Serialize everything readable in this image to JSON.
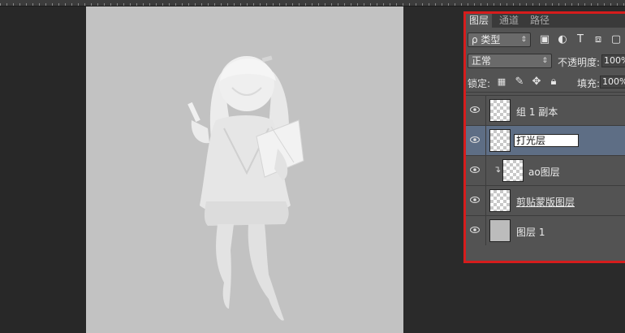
{
  "panel": {
    "tabs": [
      "图层",
      "通道",
      "路径"
    ],
    "filter": {
      "label": "ρ 类型",
      "icons": [
        "image-filter-icon",
        "adjustment-filter-icon",
        "type-filter-icon",
        "shape-filter-icon",
        "smart-object-filter-icon"
      ]
    },
    "blend_mode": "正常",
    "opacity_label": "不透明度:",
    "opacity_value": "100%",
    "lock_label": "锁定:",
    "fill_label": "填充:",
    "fill_value": "100%",
    "layers": [
      {
        "name": "组 1 副本",
        "visible": true,
        "selected": false
      },
      {
        "name": "打光层",
        "visible": true,
        "selected": true,
        "editing": true
      },
      {
        "name": "ao图层",
        "visible": true,
        "selected": false,
        "clipped": true
      },
      {
        "name": "剪贴蒙版图层",
        "visible": true,
        "selected": false
      },
      {
        "name": "图层 1",
        "visible": true,
        "selected": false
      }
    ]
  }
}
